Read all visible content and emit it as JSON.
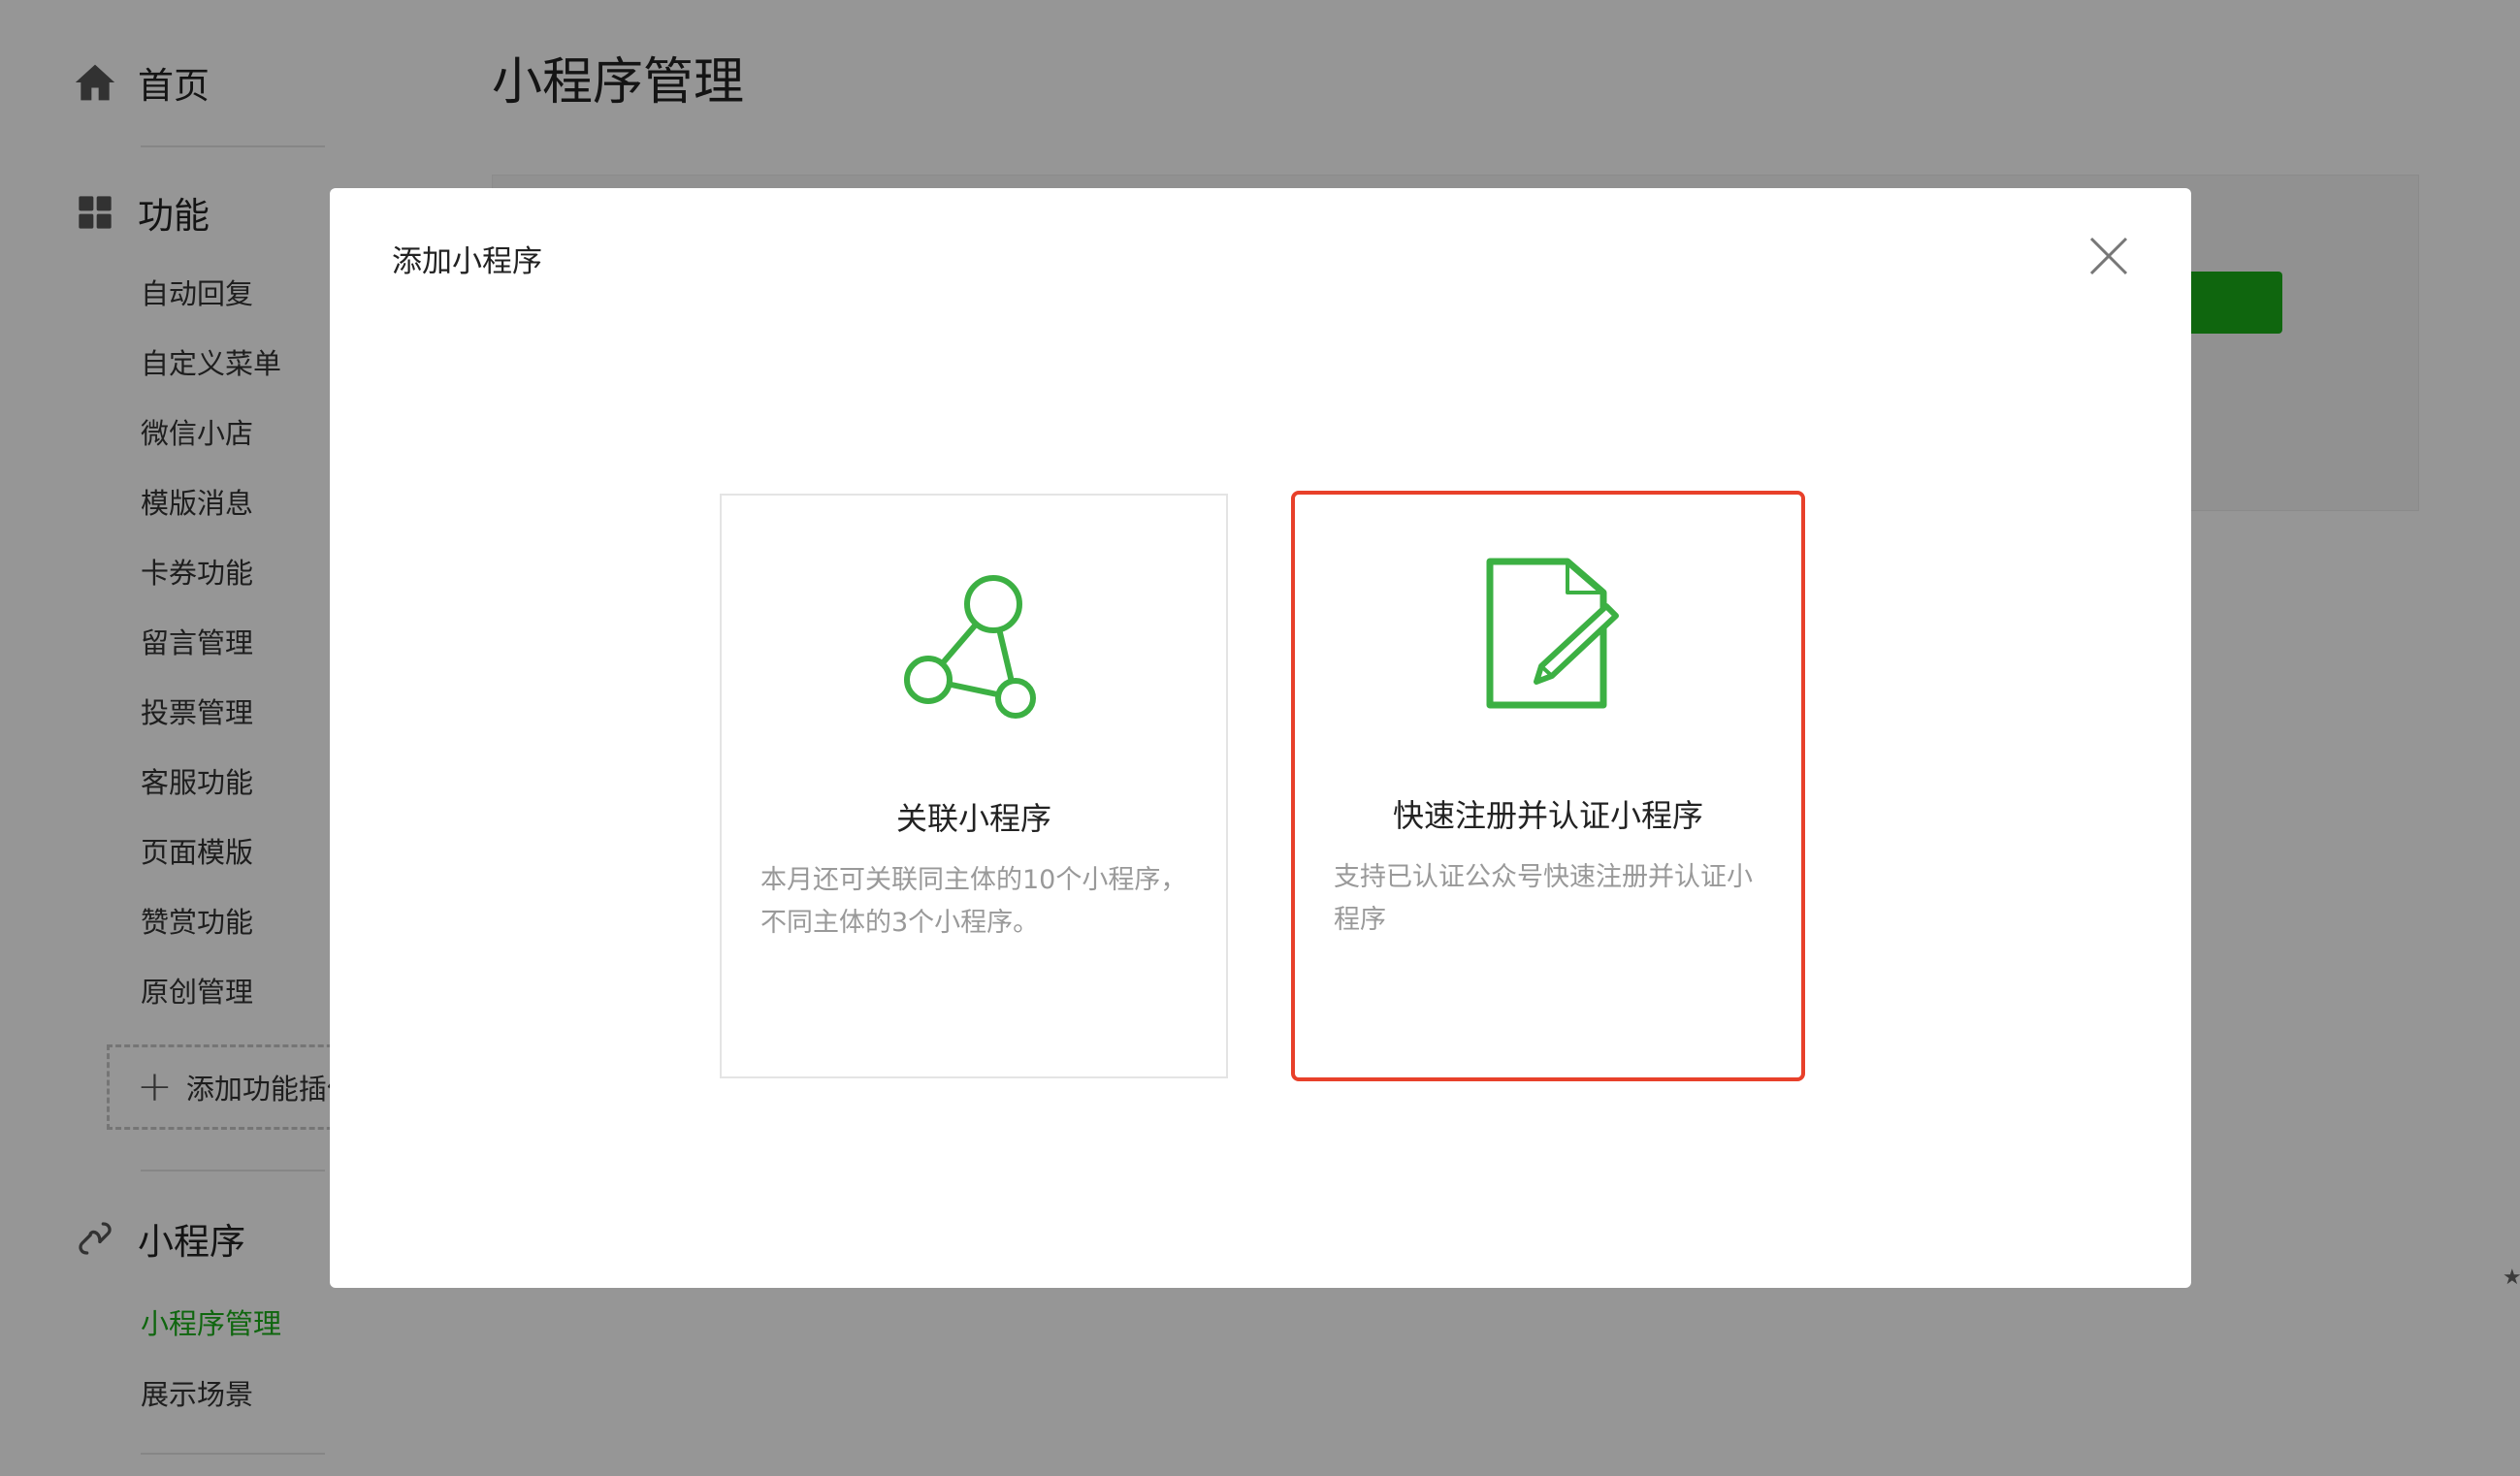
{
  "sidebar": {
    "home": {
      "label": "首页",
      "icon": "home-icon"
    },
    "features": {
      "label": "功能",
      "icon": "grid-icon",
      "items": [
        "自动回复",
        "自定义菜单",
        "微信小店",
        "模版消息",
        "卡券功能",
        "留言管理",
        "投票管理",
        "客服功能",
        "页面模版",
        "赞赏功能",
        "原创管理"
      ],
      "add_plugin_label": "添加功能插件"
    },
    "mini_program": {
      "label": "小程序",
      "icon": "link-icon",
      "items": [
        "小程序管理",
        "展示场景"
      ],
      "active_item": "小程序管理"
    }
  },
  "main": {
    "title": "小程序管理"
  },
  "modal": {
    "title": "添加小程序",
    "close_icon": "close-icon",
    "options": [
      {
        "icon": "share-nodes-icon",
        "title": "关联小程序",
        "description": "本月还可关联同主体的10个小程序，不同主体的3个小程序。"
      },
      {
        "icon": "document-edit-icon",
        "title": "快速注册并认证小程序",
        "description": "支持已认证公众号快速注册并认证小程序",
        "highlighted": true
      }
    ]
  },
  "colors": {
    "accent_green": "#1aad19",
    "highlight_red": "#e8402a",
    "overlay": "rgba(0,0,0,0.41)"
  }
}
